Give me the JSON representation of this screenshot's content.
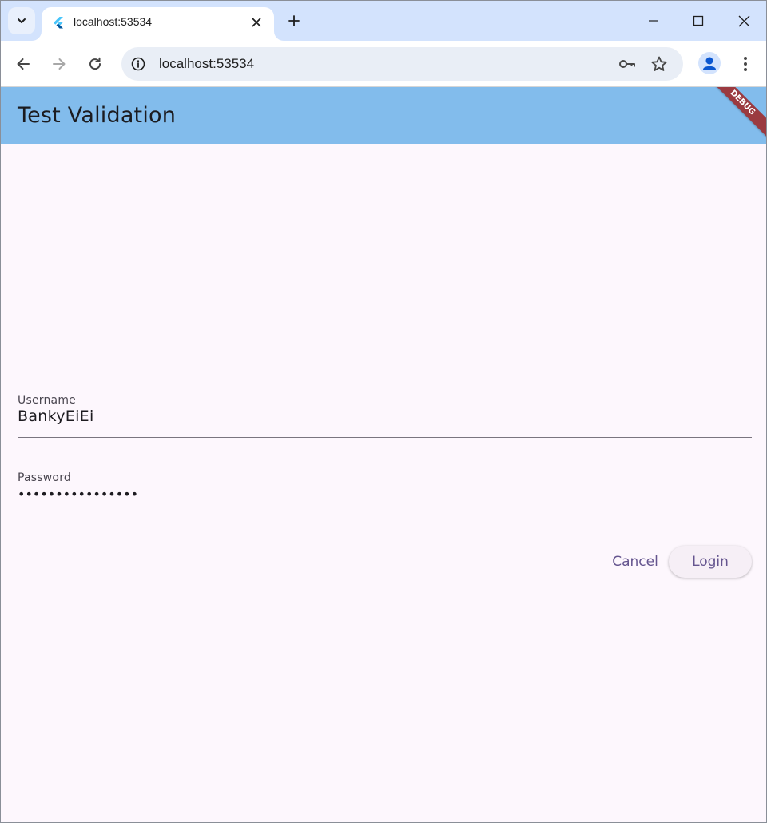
{
  "browser": {
    "tab": {
      "title": "localhost:53534",
      "favicon": "flutter-icon"
    },
    "address_bar": {
      "url": "localhost:53534"
    },
    "icons": {
      "tab_search": "chevron-down-icon",
      "tab_close": "close-icon",
      "new_tab": "plus-icon",
      "minimize": "minimize-icon",
      "maximize": "maximize-icon",
      "close": "close-window-icon",
      "back": "back-arrow-icon",
      "forward": "forward-arrow-icon",
      "reload": "reload-icon",
      "site_info": "info-icon",
      "password_key": "key-icon",
      "bookmark": "star-icon",
      "profile": "profile-icon",
      "menu": "more-vertical-icon"
    },
    "colors": {
      "tabstrip": "#d3e3fd",
      "omnibox": "#e9eef6"
    }
  },
  "app": {
    "title": "Test Validation",
    "debug_banner": "DEBUG",
    "form": {
      "username": {
        "label": "Username",
        "value": "BankyEiEi"
      },
      "password": {
        "label": "Password",
        "value": "••••••••••••••••"
      }
    },
    "actions": {
      "cancel_label": "Cancel",
      "login_label": "Login"
    },
    "colors": {
      "appbar": "#82bcec",
      "background": "#fdf7fd",
      "button_text": "#65558f",
      "debug_banner": "#9b3a40"
    }
  }
}
